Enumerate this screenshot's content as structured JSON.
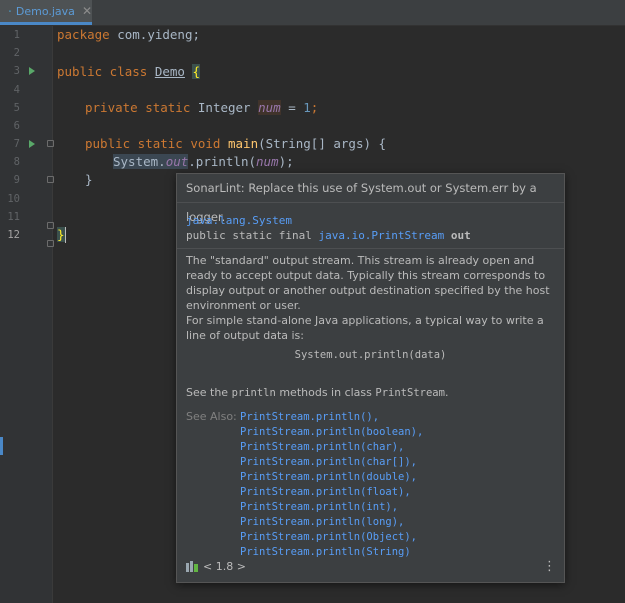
{
  "tab": {
    "label": "Demo.java",
    "close": "✕"
  },
  "gutter": {
    "lines": [
      "1",
      "2",
      "3",
      "4",
      "5",
      "6",
      "7",
      "8",
      "9",
      "10",
      "11",
      "12"
    ]
  },
  "code": {
    "l1": {
      "kw": "package ",
      "rest": "com.yideng;"
    },
    "l3": {
      "kw": "public class ",
      "cls": "Demo",
      "sp": " ",
      "brace": "{"
    },
    "l5": {
      "kw": "private static ",
      "type": "Integer ",
      "fld": "num",
      "eq": " = ",
      "num": "1",
      "semi": ";"
    },
    "l7": {
      "kw": "public static void ",
      "mth": "main",
      "rest": "(String[] args) {"
    },
    "l8": {
      "sys": "System.",
      "out": "out",
      "p1": ".println(",
      "fld": "num",
      "p2": ");"
    },
    "l9": {
      "text": "}"
    },
    "l12": {
      "text": "}"
    }
  },
  "popup": {
    "title": "SonarLint: Replace this use of System.out or System.err by a logger.",
    "def_class": "java.lang.System",
    "def_mod": "public static final ",
    "def_type": "java.io.PrintStream",
    "def_name": " out",
    "para1": "The \"standard\" output stream. This stream is already open and ready to accept output data. Typically this stream corresponds to display output or another output destination specified by the host environment or user.",
    "para2": "For simple stand-alone Java applications, a typical way to write a line of output data is:",
    "code_example": "System.out.println(data)",
    "see_pre": "See the ",
    "see_m1": "println",
    "see_mid": " methods in class ",
    "see_m2": "PrintStream",
    "see_post": ".",
    "see_also_label": "See Also:",
    "see_also": [
      "PrintStream.println(),",
      "PrintStream.println(boolean),",
      "PrintStream.println(char),",
      "PrintStream.println(char[]),",
      "PrintStream.println(double),",
      "PrintStream.println(float),",
      "PrintStream.println(int),",
      "PrintStream.println(long),",
      "PrintStream.println(Object),",
      "PrintStream.println(String)"
    ],
    "jdk": "< 1.8 >",
    "more": "⋮"
  }
}
